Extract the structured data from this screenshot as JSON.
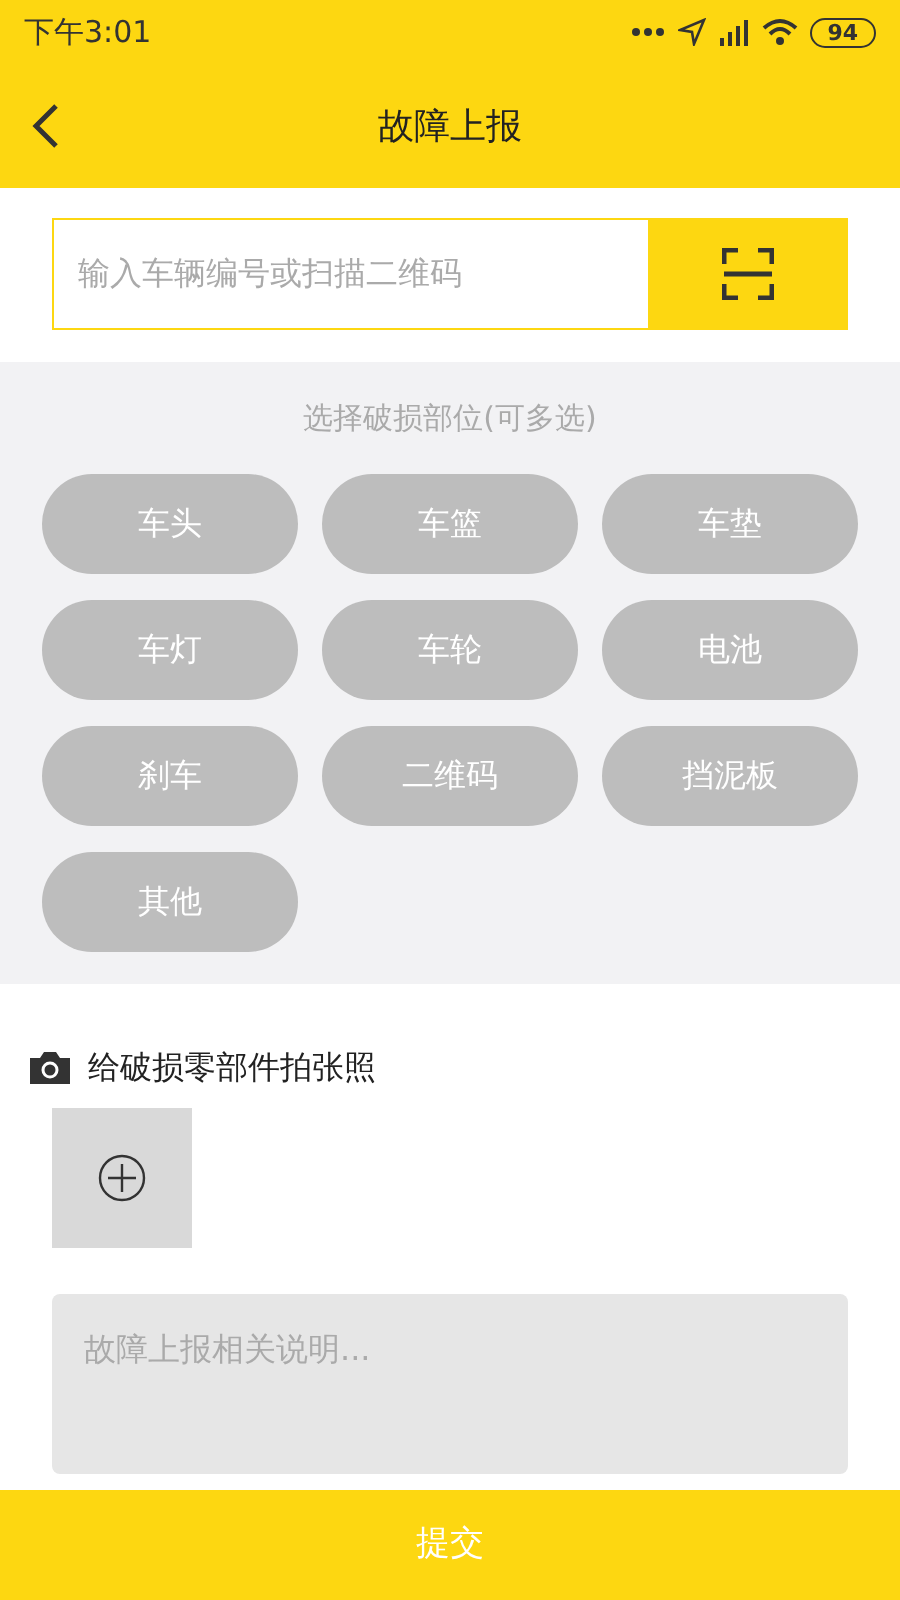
{
  "status_bar": {
    "time": "下午3:01",
    "battery": "94"
  },
  "header": {
    "title": "故障上报"
  },
  "search": {
    "placeholder": "输入车辆编号或扫描二维码"
  },
  "parts": {
    "title": "选择破损部位(可多选)",
    "items": [
      {
        "label": "车头",
        "selected": false
      },
      {
        "label": "车篮",
        "selected": false
      },
      {
        "label": "车垫",
        "selected": false
      },
      {
        "label": "车灯",
        "selected": false
      },
      {
        "label": "车轮",
        "selected": false
      },
      {
        "label": "电池",
        "selected": false
      },
      {
        "label": "刹车",
        "selected": false
      },
      {
        "label": "二维码",
        "selected": false
      },
      {
        "label": "挡泥板",
        "selected": false
      },
      {
        "label": "其他",
        "selected": false
      }
    ]
  },
  "photo": {
    "label": "给破损零部件拍张照"
  },
  "description": {
    "placeholder": "故障上报相关说明..."
  },
  "submit": {
    "label": "提交"
  }
}
